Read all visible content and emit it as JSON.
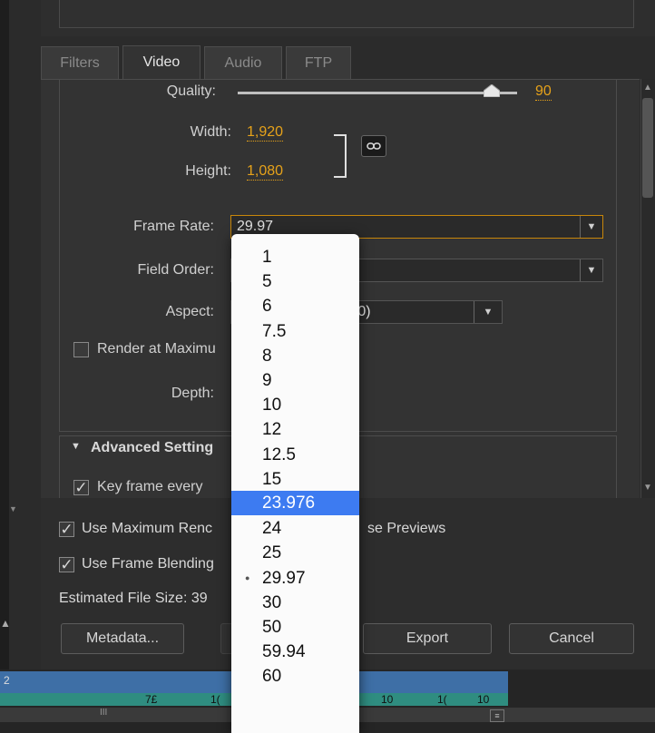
{
  "tabs": [
    {
      "label": "Filters",
      "active": false
    },
    {
      "label": "Video",
      "active": true
    },
    {
      "label": "Audio",
      "active": false
    },
    {
      "label": "FTP",
      "active": false
    }
  ],
  "video": {
    "quality_label": "Quality:",
    "quality_value": "90",
    "quality_fraction": 0.9,
    "width_label": "Width:",
    "width_value": "1,920",
    "height_label": "Height:",
    "height_value": "1,080",
    "frame_rate_label": "Frame Rate:",
    "frame_rate_value": "29.97",
    "field_order_label": "Field Order:",
    "aspect_label": "Aspect:",
    "aspect_value_visible": "...0)",
    "render_max_label": "Render at Maximu",
    "depth_label": "Depth:"
  },
  "advanced": {
    "header": "Advanced Setting",
    "key_frame_label": "Key frame every"
  },
  "bottom": {
    "use_max_render_label": "Use Maximum Renc",
    "use_previews_label": "se Previews",
    "use_frame_blending_label": "Use Frame Blending",
    "estimated_file_size_label": "Estimated File Size: 39",
    "metadata_button": "Metadata...",
    "export_button": "Export",
    "cancel_button": "Cancel"
  },
  "frame_rate_menu": {
    "items": [
      "1",
      "5",
      "6",
      "7.5",
      "8",
      "9",
      "10",
      "12",
      "12.5",
      "15",
      "23.976",
      "24",
      "25",
      "29.97",
      "30",
      "50",
      "59.94",
      "60"
    ],
    "highlighted": "23.976",
    "current": "29.97"
  },
  "timeline": {
    "labels": [
      "2",
      "7£",
      "1(",
      "10",
      "1(",
      "10",
      "III"
    ]
  },
  "colors": {
    "accent": "#e6a21a",
    "menu_highlight": "#3d7bf1",
    "panel": "#333333"
  }
}
